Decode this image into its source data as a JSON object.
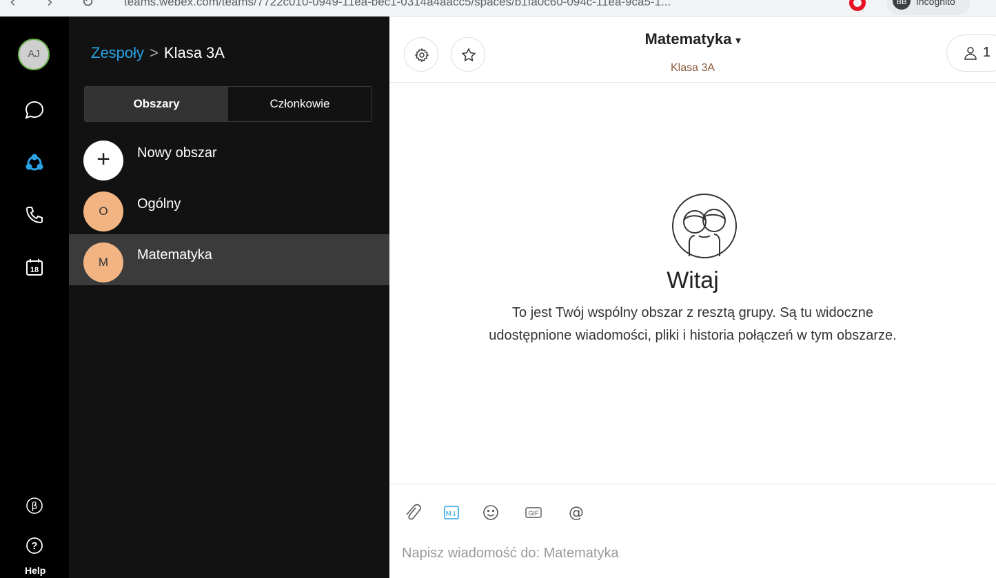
{
  "browser": {
    "url": "teams.webex.com/teams/7722c010-0949-11ea-bec1-0314a4aacc5/spaces/b1fa0c60-094c-11ea-9ca5-1...",
    "incognito_label": "Incognito",
    "profile_initials": "BB"
  },
  "rail": {
    "avatar_initials": "AJ",
    "calendar_day": "18",
    "help_label": "Help",
    "items": [
      "messaging-icon",
      "teams-icon",
      "calls-icon",
      "calendar-icon",
      "beta-icon",
      "help-icon"
    ]
  },
  "panel": {
    "breadcrumb": {
      "parent": "Zespoły",
      "separator": ">",
      "current": "Klasa 3A"
    },
    "tabs": [
      {
        "label": "Obszary",
        "active": true
      },
      {
        "label": "Członkowie",
        "active": false
      }
    ],
    "new_space": {
      "icon": "+",
      "label": "Nowy obszar"
    },
    "spaces": [
      {
        "initial": "O",
        "name": "Ogólny",
        "selected": false
      },
      {
        "initial": "M",
        "name": "Matematyka",
        "selected": true
      }
    ]
  },
  "header": {
    "title": "Matematyka",
    "caret": "▾",
    "subtitle": "Klasa 3A",
    "people_count": "1"
  },
  "welcome": {
    "title": "Witaj",
    "text": "To jest Twój wspólny obszar z resztą grupy. Są tu widoczne udostępnione wiadomości, pliki i historia połączeń w tym obszarze."
  },
  "composer": {
    "placeholder": "Napisz wiadomość do: Matematyka",
    "tools": [
      "attach-icon",
      "markdown-icon",
      "emoji-icon",
      "gif-icon",
      "mention-icon"
    ]
  },
  "colors": {
    "accent": "#2aa3e5",
    "space_avatar": "#f2b482",
    "selected_row": "#3b3b3b",
    "rail_bg": "#000000",
    "panel_bg": "#121212"
  }
}
